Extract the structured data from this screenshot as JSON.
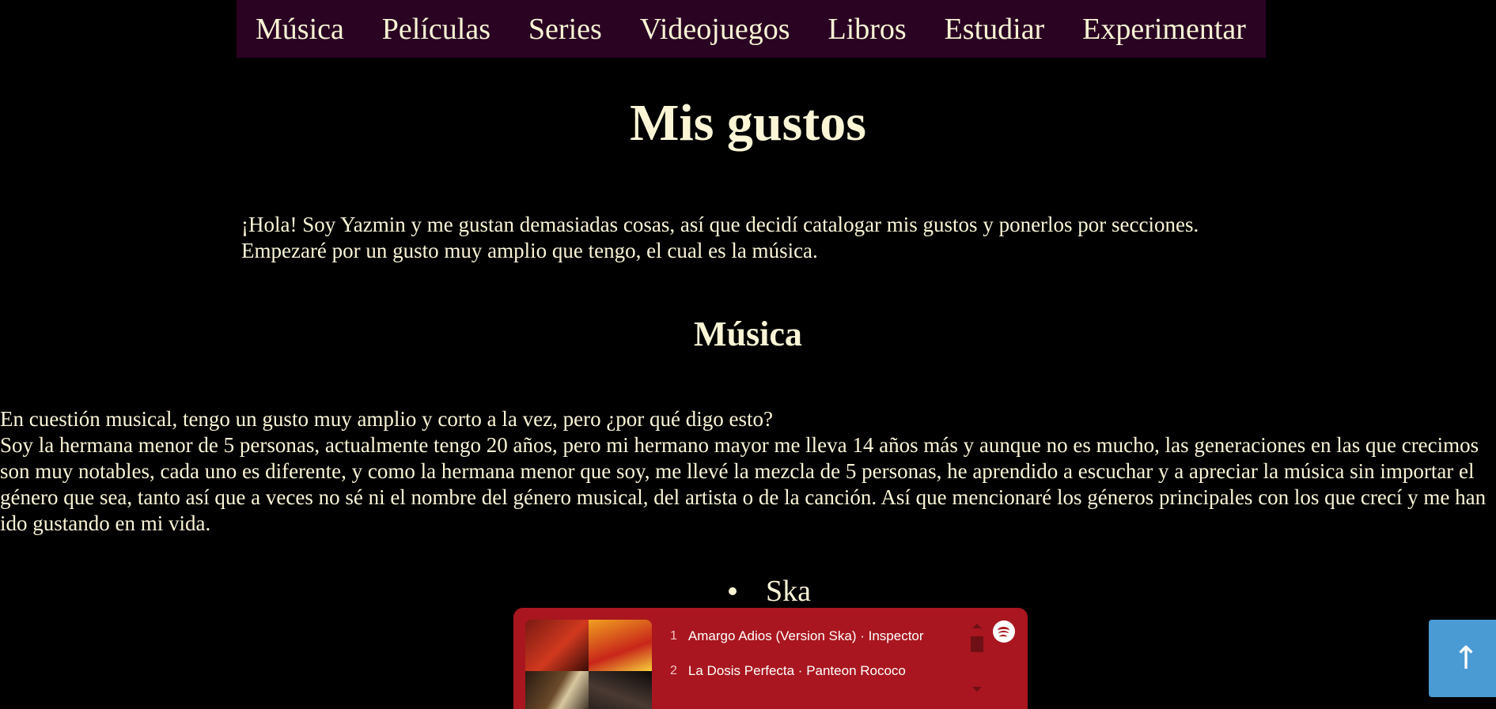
{
  "nav": {
    "items": [
      {
        "label": "Música"
      },
      {
        "label": "Películas"
      },
      {
        "label": "Series"
      },
      {
        "label": "Videojuegos"
      },
      {
        "label": "Libros"
      },
      {
        "label": "Estudiar"
      },
      {
        "label": "Experimentar"
      }
    ]
  },
  "page_title": "Mis gustos",
  "intro": {
    "line1": "¡Hola! Soy Yazmin y me gustan demasiadas cosas, así que decidí catalogar mis gustos y ponerlos por secciones.",
    "line2": "Empezaré por un gusto muy amplio que tengo, el cual es la música."
  },
  "musica": {
    "heading": "Música",
    "line1": "En cuestión musical, tengo un gusto muy amplio y corto a la vez, pero ¿por qué digo esto?",
    "paragraph": "Soy la hermana menor de 5 personas, actualmente tengo 20 años, pero mi hermano mayor me lleva 14 años más y aunque no es mucho, las generaciones en las que crecimos son muy notables, cada uno es diferente, y como la hermana menor que soy, me llevé la mezcla de 5 personas, he aprendido a escuchar y a apreciar la música sin importar el género que sea, tanto así que a veces no sé ni el nombre del género musical, del artista o de la canción. Así que mencionaré los géneros principales con los que crecí y me han ido gustando en mi vida.",
    "genres": [
      {
        "label": "Ska"
      }
    ]
  },
  "player": {
    "tracks": [
      {
        "num": "1",
        "title": "Amargo Adios (Version Ska) · Inspector"
      },
      {
        "num": "2",
        "title": "La Dosis Perfecta · Panteon Rococo"
      }
    ],
    "icon": "spotify-icon",
    "accent": "#a9161f"
  },
  "back_to_top": {
    "glyph": "↑",
    "color": "#4a9ad4"
  }
}
